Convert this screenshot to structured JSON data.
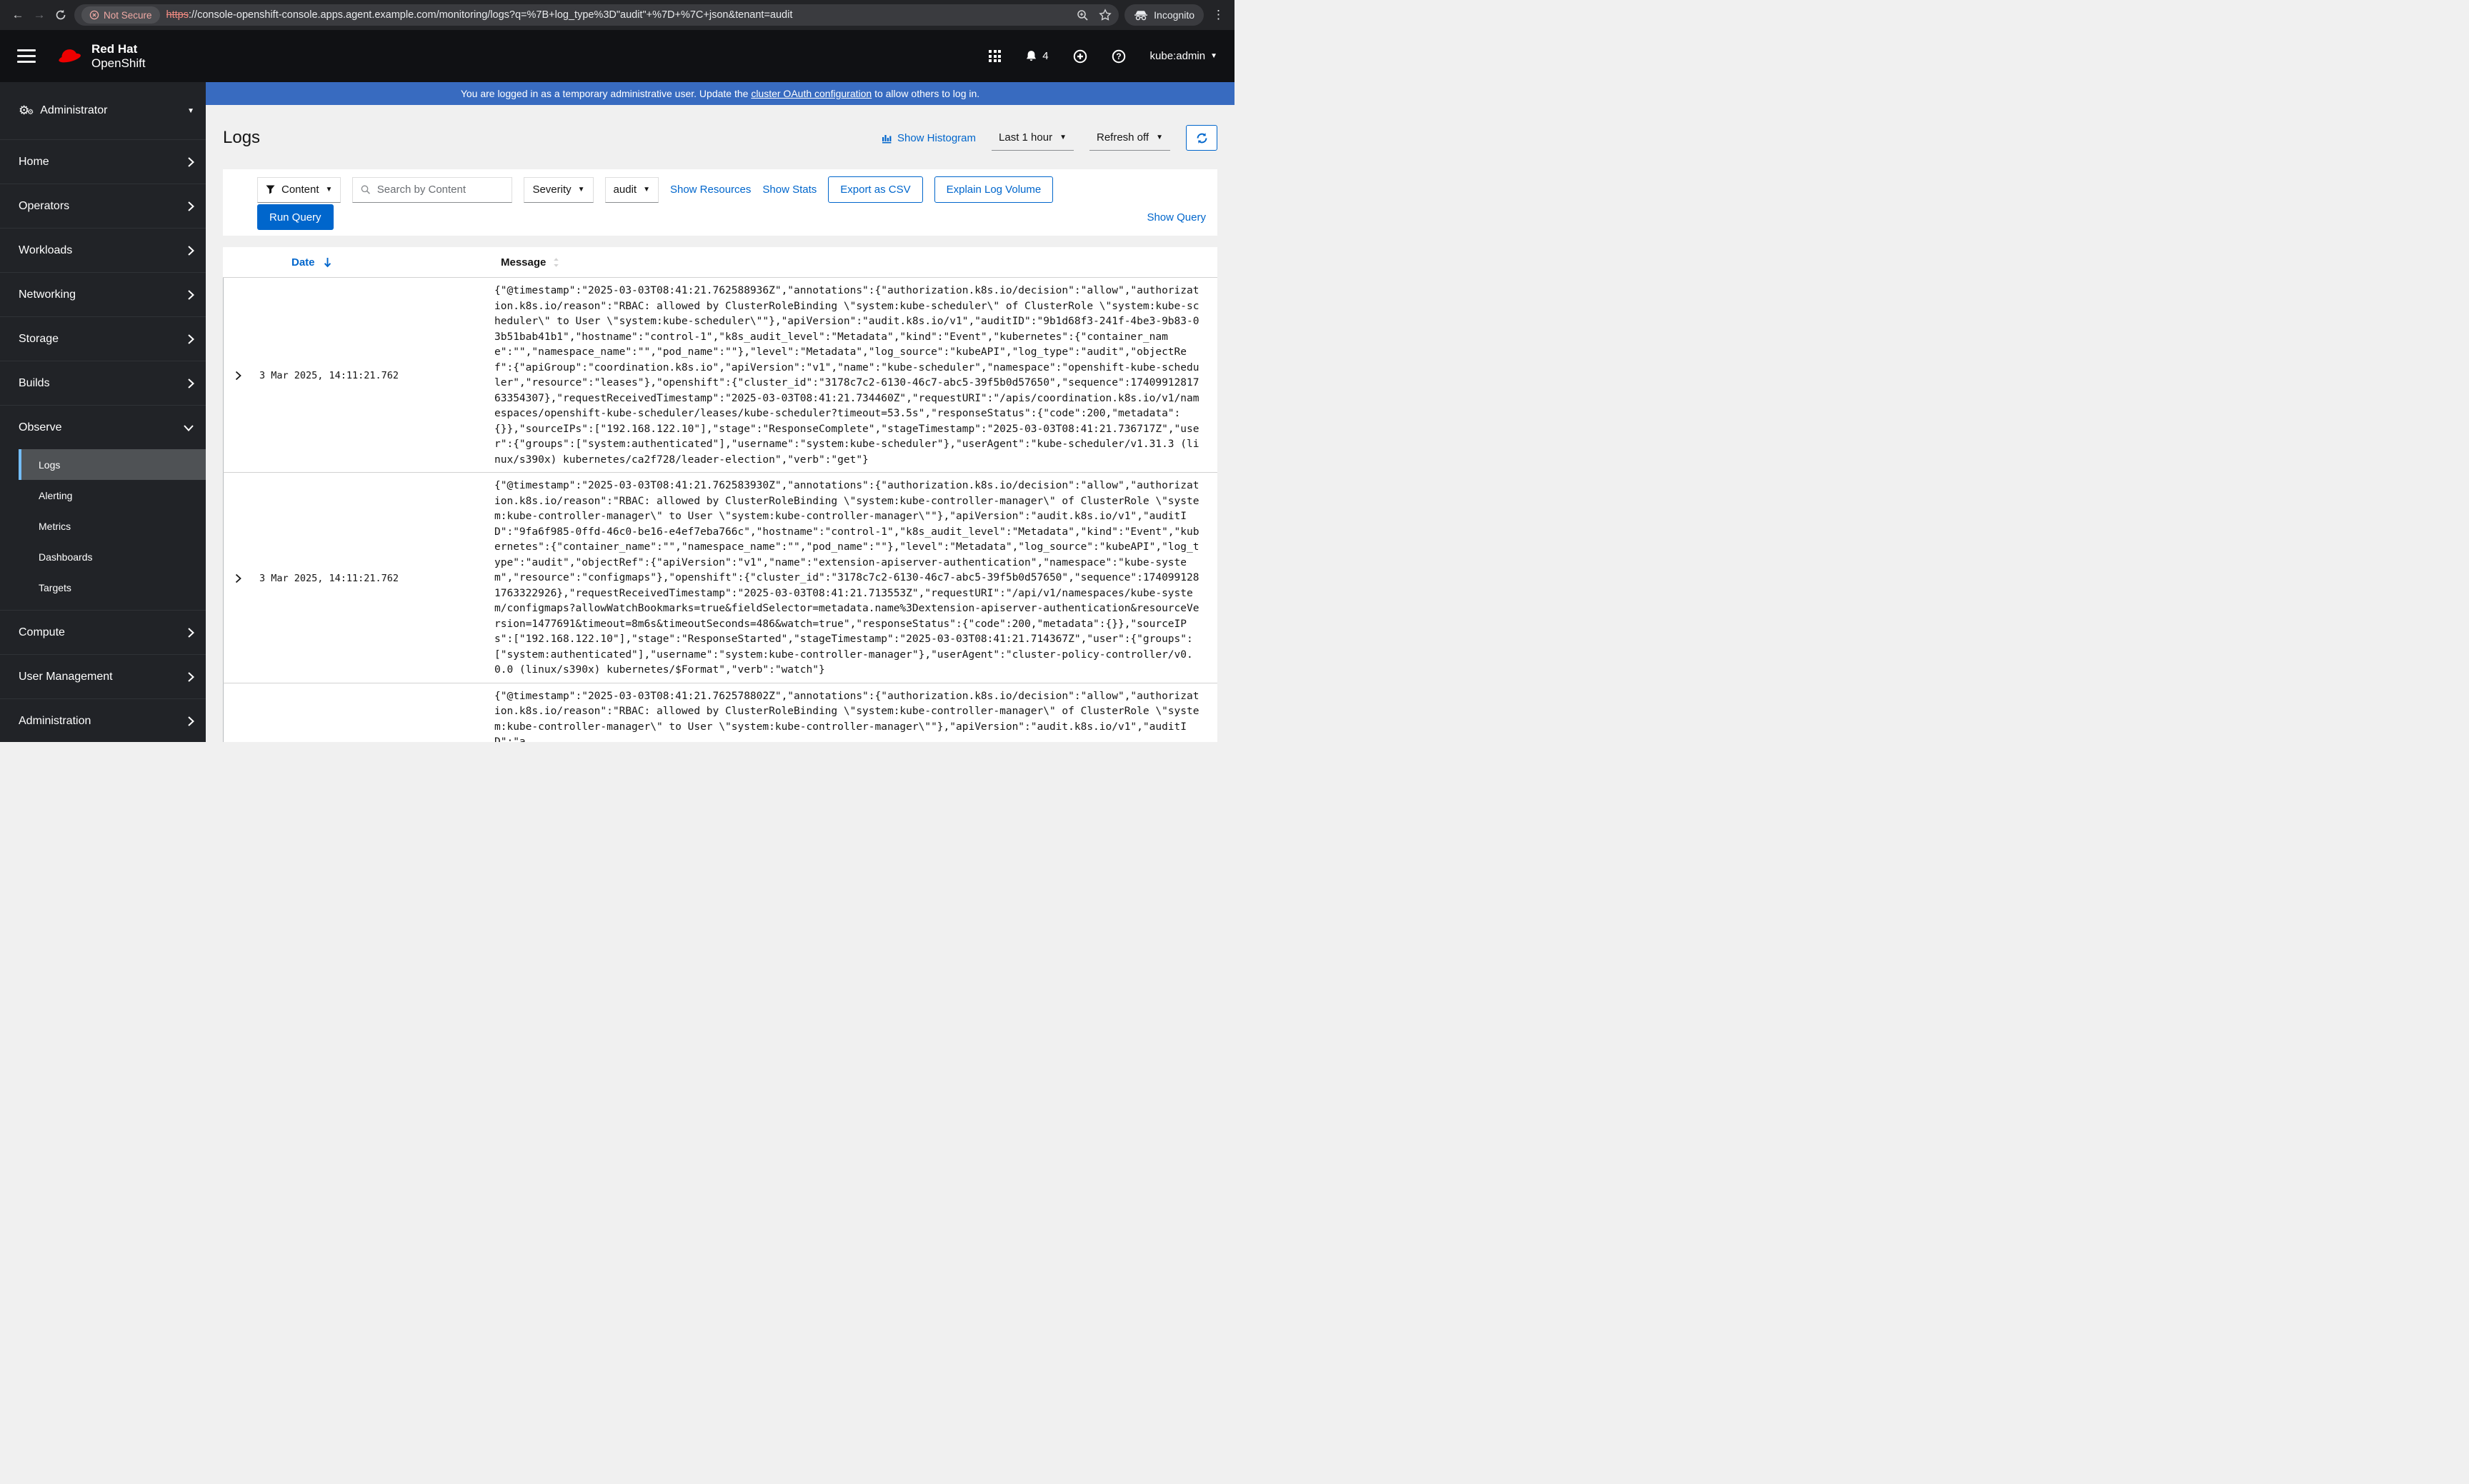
{
  "browser": {
    "security_label": "Not Secure",
    "url_scheme": "https",
    "url_rest": "://console-openshift-console.apps.agent.example.com/monitoring/logs?q=%7B+log_type%3D\"audit\"+%7D+%7C+json&tenant=audit",
    "incognito_label": "Incognito"
  },
  "masthead": {
    "brand_top": "Red Hat",
    "brand_bottom": "OpenShift",
    "notification_count": "4",
    "user_menu": "kube:admin"
  },
  "banner": {
    "prefix": "You are logged in as a temporary administrative user. Update the ",
    "link_text": "cluster OAuth configuration",
    "suffix": " to allow others to log in."
  },
  "sidebar": {
    "perspective": "Administrator",
    "groups_top": [
      "Home",
      "Operators",
      "Workloads",
      "Networking",
      "Storage",
      "Builds"
    ],
    "observe": "Observe",
    "observe_items": [
      "Logs",
      "Alerting",
      "Metrics",
      "Dashboards",
      "Targets"
    ],
    "groups_bottom": [
      "Compute",
      "User Management",
      "Administration"
    ]
  },
  "page": {
    "title": "Logs",
    "show_histogram": "Show Histogram",
    "time_range": "Last 1 hour",
    "refresh": "Refresh off"
  },
  "toolbar": {
    "attribute_filter": "Content",
    "search_placeholder": "Search by Content",
    "severity": "Severity",
    "tenant": "audit",
    "show_resources": "Show Resources",
    "show_stats": "Show Stats",
    "export_csv": "Export as CSV",
    "explain_log_volume": "Explain Log Volume",
    "run_query": "Run Query",
    "show_query": "Show Query"
  },
  "table": {
    "date_header": "Date",
    "message_header": "Message",
    "rows": [
      {
        "date": "3 Mar 2025, 14:11:21.762",
        "message": "{\"@timestamp\":\"2025-03-03T08:41:21.762588936Z\",\"annotations\":{\"authorization.k8s.io/decision\":\"allow\",\"authorization.k8s.io/reason\":\"RBAC: allowed by ClusterRoleBinding \\\"system:kube-scheduler\\\" of ClusterRole \\\"system:kube-scheduler\\\" to User \\\"system:kube-scheduler\\\"\"},\"apiVersion\":\"audit.k8s.io/v1\",\"auditID\":\"9b1d68f3-241f-4be3-9b83-03b51bab41b1\",\"hostname\":\"control-1\",\"k8s_audit_level\":\"Metadata\",\"kind\":\"Event\",\"kubernetes\":{\"container_name\":\"\",\"namespace_name\":\"\",\"pod_name\":\"\"},\"level\":\"Metadata\",\"log_source\":\"kubeAPI\",\"log_type\":\"audit\",\"objectRef\":{\"apiGroup\":\"coordination.k8s.io\",\"apiVersion\":\"v1\",\"name\":\"kube-scheduler\",\"namespace\":\"openshift-kube-scheduler\",\"resource\":\"leases\"},\"openshift\":{\"cluster_id\":\"3178c7c2-6130-46c7-abc5-39f5b0d57650\",\"sequence\":1740991281763354307},\"requestReceivedTimestamp\":\"2025-03-03T08:41:21.734460Z\",\"requestURI\":\"/apis/coordination.k8s.io/v1/namespaces/openshift-kube-scheduler/leases/kube-scheduler?timeout=53.5s\",\"responseStatus\":{\"code\":200,\"metadata\":{}},\"sourceIPs\":[\"192.168.122.10\"],\"stage\":\"ResponseComplete\",\"stageTimestamp\":\"2025-03-03T08:41:21.736717Z\",\"user\":{\"groups\":[\"system:authenticated\"],\"username\":\"system:kube-scheduler\"},\"userAgent\":\"kube-scheduler/v1.31.3 (linux/s390x) kubernetes/ca2f728/leader-election\",\"verb\":\"get\"}"
      },
      {
        "date": "3 Mar 2025, 14:11:21.762",
        "message": "{\"@timestamp\":\"2025-03-03T08:41:21.762583930Z\",\"annotations\":{\"authorization.k8s.io/decision\":\"allow\",\"authorization.k8s.io/reason\":\"RBAC: allowed by ClusterRoleBinding \\\"system:kube-controller-manager\\\" of ClusterRole \\\"system:kube-controller-manager\\\" to User \\\"system:kube-controller-manager\\\"\"},\"apiVersion\":\"audit.k8s.io/v1\",\"auditID\":\"9fa6f985-0ffd-46c0-be16-e4ef7eba766c\",\"hostname\":\"control-1\",\"k8s_audit_level\":\"Metadata\",\"kind\":\"Event\",\"kubernetes\":{\"container_name\":\"\",\"namespace_name\":\"\",\"pod_name\":\"\"},\"level\":\"Metadata\",\"log_source\":\"kubeAPI\",\"log_type\":\"audit\",\"objectRef\":{\"apiVersion\":\"v1\",\"name\":\"extension-apiserver-authentication\",\"namespace\":\"kube-system\",\"resource\":\"configmaps\"},\"openshift\":{\"cluster_id\":\"3178c7c2-6130-46c7-abc5-39f5b0d57650\",\"sequence\":1740991281763322926},\"requestReceivedTimestamp\":\"2025-03-03T08:41:21.713553Z\",\"requestURI\":\"/api/v1/namespaces/kube-system/configmaps?allowWatchBookmarks=true&fieldSelector=metadata.name%3Dextension-apiserver-authentication&resourceVersion=1477691&timeout=8m6s&timeoutSeconds=486&watch=true\",\"responseStatus\":{\"code\":200,\"metadata\":{}},\"sourceIPs\":[\"192.168.122.10\"],\"stage\":\"ResponseStarted\",\"stageTimestamp\":\"2025-03-03T08:41:21.714367Z\",\"user\":{\"groups\":[\"system:authenticated\"],\"username\":\"system:kube-controller-manager\"},\"userAgent\":\"cluster-policy-controller/v0.0.0 (linux/s390x) kubernetes/$Format\",\"verb\":\"watch\"}"
      },
      {
        "date": "",
        "message": "{\"@timestamp\":\"2025-03-03T08:41:21.762578802Z\",\"annotations\":{\"authorization.k8s.io/decision\":\"allow\",\"authorization.k8s.io/reason\":\"RBAC: allowed by ClusterRoleBinding \\\"system:kube-controller-manager\\\" of ClusterRole \\\"system:kube-controller-manager\\\" to User \\\"system:kube-controller-manager\\\"\"},\"apiVersion\":\"audit.k8s.io/v1\",\"auditID\":\"a"
      }
    ]
  },
  "colors": {
    "accent_blue": "#0066cc",
    "banner_blue": "#386bc0",
    "brand_red": "#ee0000",
    "nav_selected_bg": "#4f5255",
    "nav_active_border": "#73bcf7"
  }
}
